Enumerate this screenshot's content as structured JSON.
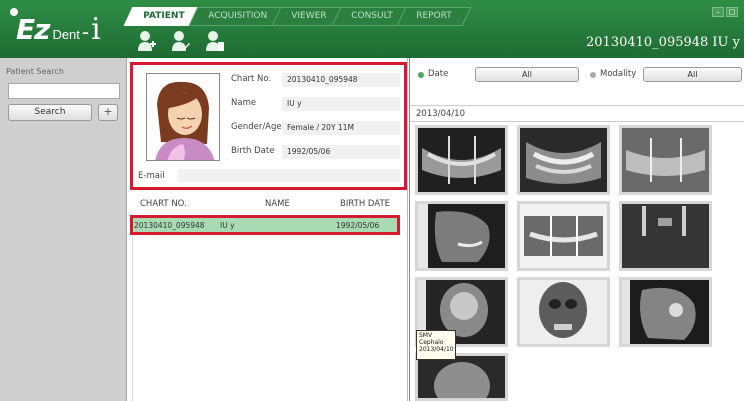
{
  "app": {
    "logo_brand": "Ez",
    "logo_dent": "Dent",
    "logo_dash": "-",
    "logo_i": "i",
    "patient_header": "20130410_095948 IU y"
  },
  "tabs": [
    {
      "label": "PATIENT",
      "active": true
    },
    {
      "label": "ACQUISITION",
      "active": false
    },
    {
      "label": "VIEWER",
      "active": false
    },
    {
      "label": "CONSULT",
      "active": false
    },
    {
      "label": "REPORT",
      "active": false
    }
  ],
  "toolbar_icons": [
    "new-patient-icon",
    "edit-patient-icon",
    "delete-patient-icon"
  ],
  "window_controls": [
    "minimize-icon",
    "maximize-icon"
  ],
  "search": {
    "title": "Patient Search",
    "input_value": "",
    "button_label": "Search",
    "add_label": "+"
  },
  "patient": {
    "chart_label": "Chart No.",
    "chart_value": "20130410_095948",
    "name_label": "Name",
    "name_value": "IU y",
    "gender_label": "Gender/Age",
    "gender_value": "Female / 20Y 11M",
    "birth_label": "Birth Date",
    "birth_value": "1992/05/06",
    "email_label": "E-mail",
    "email_value": ""
  },
  "list": {
    "headers": [
      "CHART NO.",
      "NAME",
      "BIRTH DATE"
    ],
    "rows": [
      {
        "chart": "20130410_095948",
        "name": "IU y",
        "birth": "1992/05/06",
        "selected": true
      }
    ]
  },
  "filters": {
    "date_label": "Date",
    "date_value": "All",
    "modality_label": "Modality",
    "modality_value": "All",
    "date_selected": true
  },
  "images": {
    "date_heading": "2013/04/10",
    "tooltip_lines": [
      "SMV",
      "Cephalo",
      "2013/04/10"
    ]
  },
  "colors": {
    "brand_green": "#2f8e45",
    "highlight_red": "#d7192f",
    "selected_row": "#a8dab3"
  }
}
